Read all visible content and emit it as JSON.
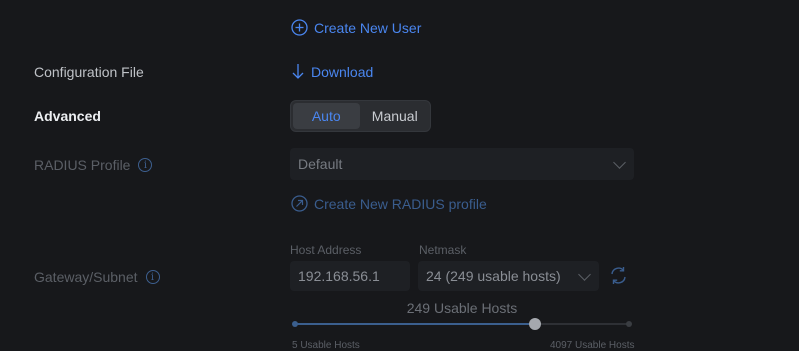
{
  "create_user": {
    "label": "Create New User"
  },
  "config_file": {
    "label": "Configuration File",
    "download_label": "Download"
  },
  "advanced": {
    "label": "Advanced",
    "options": [
      "Auto",
      "Manual"
    ],
    "selected": "Auto"
  },
  "radius": {
    "label": "RADIUS Profile",
    "selected": "Default",
    "create_label": "Create New RADIUS profile"
  },
  "gateway": {
    "label": "Gateway/Subnet",
    "host_label": "Host Address",
    "host_value": "192.168.56.1",
    "netmask_label": "Netmask",
    "netmask_value": "24 (249 usable hosts)",
    "usable_hosts_text": "249 Usable Hosts",
    "slider_fraction": 0.72,
    "min_text": "5 Usable Hosts",
    "max_text": "4097 Usable Hosts"
  }
}
